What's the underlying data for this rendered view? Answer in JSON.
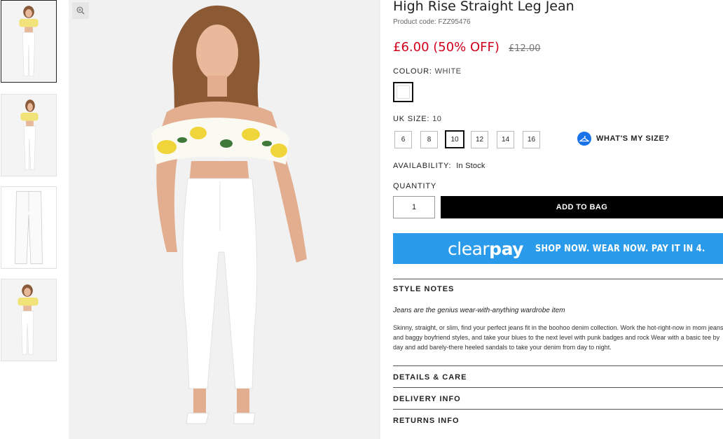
{
  "product": {
    "title": "High Rise Straight Leg Jean",
    "code": "Product code: FZZ95476",
    "price": "£6.00 (50% OFF)",
    "was_price": "£12.00"
  },
  "colour": {
    "label": "COLOUR:",
    "value": "WHITE",
    "swatch_color": "#ffffff"
  },
  "size": {
    "label": "UK SIZE:",
    "value": "10",
    "options": [
      "6",
      "8",
      "10",
      "12",
      "14",
      "16"
    ],
    "selected": "10",
    "whats_my_size": "WHAT'S MY SIZE?"
  },
  "availability": {
    "label": "AVAILABILITY:",
    "value": "In Stock"
  },
  "quantity": {
    "label": "QUANTITY",
    "value": "1"
  },
  "add_to_bag": "ADD TO BAG",
  "clearpay": {
    "logo_light": "clear",
    "logo_bold": "pay",
    "tagline": "SHOP NOW. WEAR NOW. PAY IT IN 4.",
    "bg_color": "#2a9bea"
  },
  "style_notes": {
    "heading": "STYLE NOTES",
    "tagline": "Jeans are the genius wear-with-anything wardrobe item",
    "body": "Skinny, straight, or slim, find your perfect jeans fit in the boohoo denim collection. Work the hot-right-now in mom jeans and baggy boyfriend styles, and take your blues to the next level with punk badges and rock Wear with a basic tee by day and add barely-there heeled sandals to take your denim from day to night."
  },
  "sections": [
    "DETAILS & CARE",
    "DELIVERY INFO",
    "RETURNS INFO"
  ],
  "colors": {
    "sale_red": "#d0021b",
    "button_black": "#000000"
  },
  "icons": {
    "zoom": "zoom-in-icon",
    "hanger": "hanger-icon"
  }
}
